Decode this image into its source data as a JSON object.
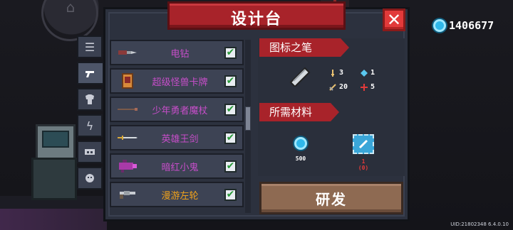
{
  "title": "设计台",
  "currency": {
    "icon": "gem-icon",
    "amount": "1406677"
  },
  "tabs": [
    {
      "icon": "list-icon",
      "active": false
    },
    {
      "icon": "gun-icon",
      "active": true
    },
    {
      "icon": "armor-icon",
      "active": false
    },
    {
      "icon": "lightning-icon",
      "active": false
    },
    {
      "icon": "machine-icon",
      "active": false
    },
    {
      "icon": "pet-icon",
      "active": false
    }
  ],
  "items": [
    {
      "name": "电钻",
      "color": "#c64ec9",
      "icon": "drill-icon",
      "checked": true
    },
    {
      "name": "超级怪兽卡牌",
      "color": "#c64ec9",
      "icon": "card-icon",
      "checked": true
    },
    {
      "name": "少年勇者魔杖",
      "color": "#c64ec9",
      "icon": "staff-icon",
      "checked": true
    },
    {
      "name": "英雄王剑",
      "color": "#c64ec9",
      "icon": "sword-icon",
      "checked": true
    },
    {
      "name": "暗红小鬼",
      "color": "#c64ec9",
      "icon": "imp-gun-icon",
      "checked": true
    },
    {
      "name": "漫游左轮",
      "color": "#f0a21b",
      "icon": "revolver-icon",
      "checked": true
    }
  ],
  "detail": {
    "blueprint_label": "图标之笔",
    "weapon_icon": "pen-icon",
    "stats": {
      "damage": "3",
      "energy": "1",
      "crit": "20",
      "accuracy": "5"
    },
    "materials_label": "所需材料",
    "materials": [
      {
        "icon": "gem-icon",
        "amount": "500"
      },
      {
        "icon": "chip-icon",
        "amount": "1",
        "owned": "(0)"
      }
    ],
    "research_button": "研发"
  },
  "uid_text": "UID:21802348 6.4.0.10"
}
